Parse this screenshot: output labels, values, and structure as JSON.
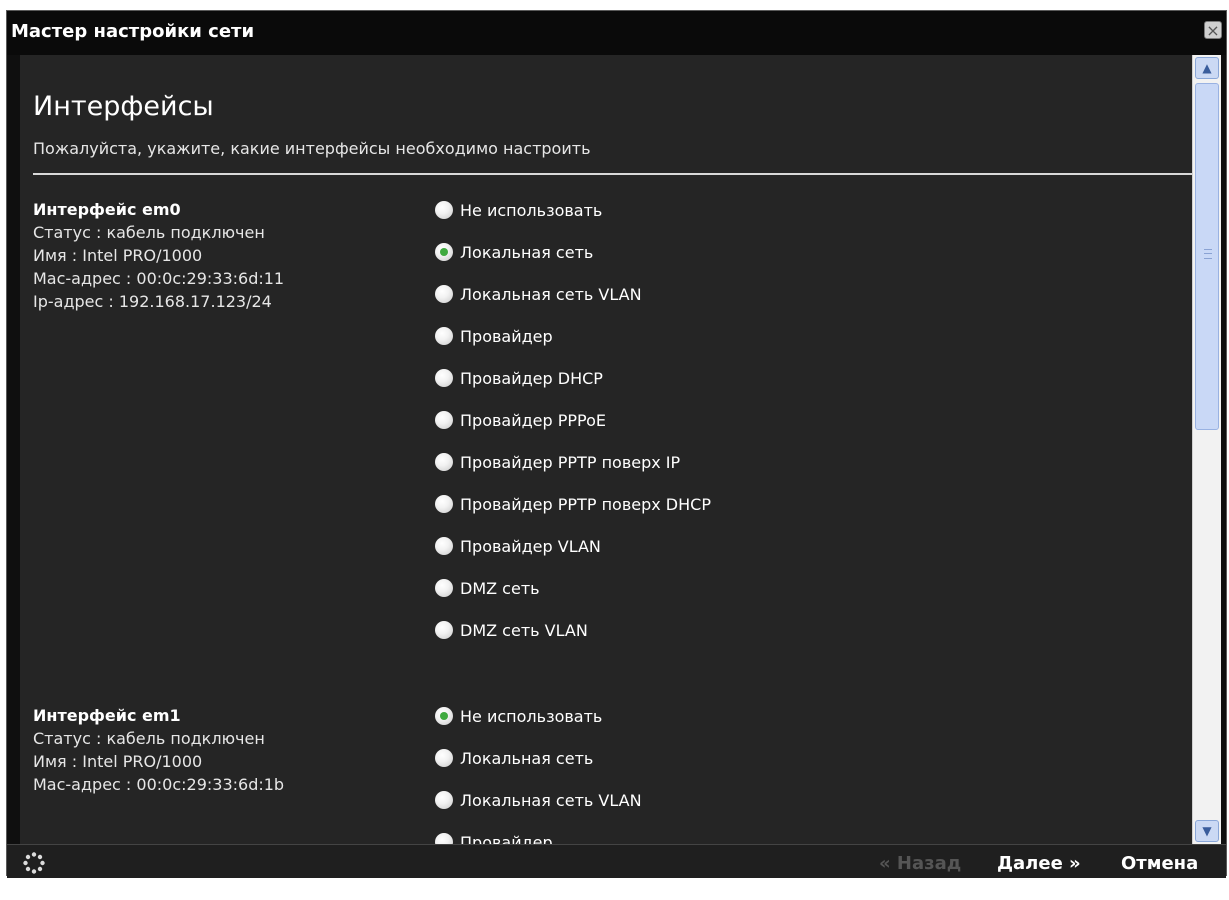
{
  "window": {
    "title": "Мастер настройки сети",
    "close_glyph": "×"
  },
  "page": {
    "title": "Интерфейсы",
    "subtitle": "Пожалуйста, укажите, какие интерфейсы необходимо настроить"
  },
  "interfaces": [
    {
      "name": "Интерфейс em0",
      "lines": [
        "Статус : кабель подключен",
        "Имя : Intel PRO/1000",
        "Mac-адрес : 00:0c:29:33:6d:11",
        "Ip-адрес : 192.168.17.123/24"
      ],
      "options": [
        "Не использовать",
        "Локальная сеть",
        "Локальная сеть VLAN",
        "Провайдер",
        "Провайдер DHCP",
        "Провайдер PPPoE",
        "Провайдер PPTP поверх IP",
        "Провайдер PPTP поверх DHCP",
        "Провайдер VLAN",
        "DMZ сеть",
        "DMZ сеть VLAN"
      ],
      "selected": "Локальная сеть"
    },
    {
      "name": "Интерфейс em1",
      "lines": [
        "Статус : кабель подключен",
        "Имя : Intel PRO/1000",
        "Mac-адрес : 00:0c:29:33:6d:1b"
      ],
      "options": [
        "Не использовать",
        "Локальная сеть",
        "Локальная сеть VLAN",
        "Провайдер"
      ],
      "selected": "Не использовать"
    }
  ],
  "footer": {
    "back_label": "« Назад",
    "next_label": "Далее »",
    "cancel_label": "Отмена"
  },
  "icons": {
    "close": "close-icon",
    "spinner": "loading-spinner-icon",
    "scroll_up": "chevron-up-icon",
    "scroll_down": "chevron-down-icon"
  },
  "colors": {
    "background": "#252525",
    "titlebar": "#0a0a0a",
    "text": "#ffffff",
    "radio_selected": "#3faa3f",
    "disabled_text": "#555555",
    "scroll_thumb": "#c9d8f6"
  }
}
